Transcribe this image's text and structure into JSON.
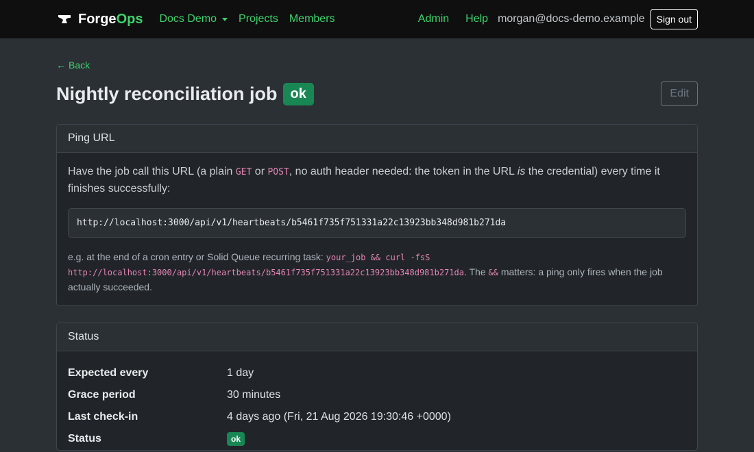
{
  "nav": {
    "brand_primary": "Forge",
    "brand_accent": "Ops",
    "org_menu_label": "Docs Demo",
    "projects_label": "Projects",
    "members_label": "Members",
    "admin_label": "Admin",
    "help_label": "Help",
    "user_email": "morgan@docs-demo.example",
    "signout_label": "Sign out"
  },
  "page": {
    "back_label": "Back",
    "title": "Nightly reconciliation job",
    "status_badge": "ok",
    "edit_label": "Edit"
  },
  "ping_card": {
    "header": "Ping URL",
    "lead_part1": "Have the job call this URL (a plain ",
    "lead_get": "GET",
    "lead_or": " or ",
    "lead_post": "POST",
    "lead_part2": ", no auth header needed: the token in the URL ",
    "lead_is": "is",
    "lead_part3": " the credential) every time it finishes successfully:",
    "url": "http://localhost:3000/api/v1/heartbeats/b5461f735f751331a22c13923bb348d981b271da",
    "hint_part1": "e.g. at the end of a cron entry or Solid Queue recurring task: ",
    "hint_cmd": "your_job && curl -fsS http://localhost:3000/api/v1/heartbeats/b5461f735f751331a22c13923bb348d981b271da",
    "hint_part2": ". The ",
    "hint_amp": "&&",
    "hint_part3": " matters: a ping only fires when the job actually succeeded."
  },
  "status_card": {
    "header": "Status",
    "rows": [
      {
        "key": "Expected every",
        "value": "1 day"
      },
      {
        "key": "Grace period",
        "value": "30 minutes"
      },
      {
        "key": "Last check-in",
        "value": "4 days ago (Fri, 21 Aug 2026 19:30:46 +0000)"
      },
      {
        "key": "Status",
        "value": "ok"
      }
    ]
  },
  "colors": {
    "accent": "#3fd16b",
    "success": "#198754",
    "code": "#e685b5"
  }
}
